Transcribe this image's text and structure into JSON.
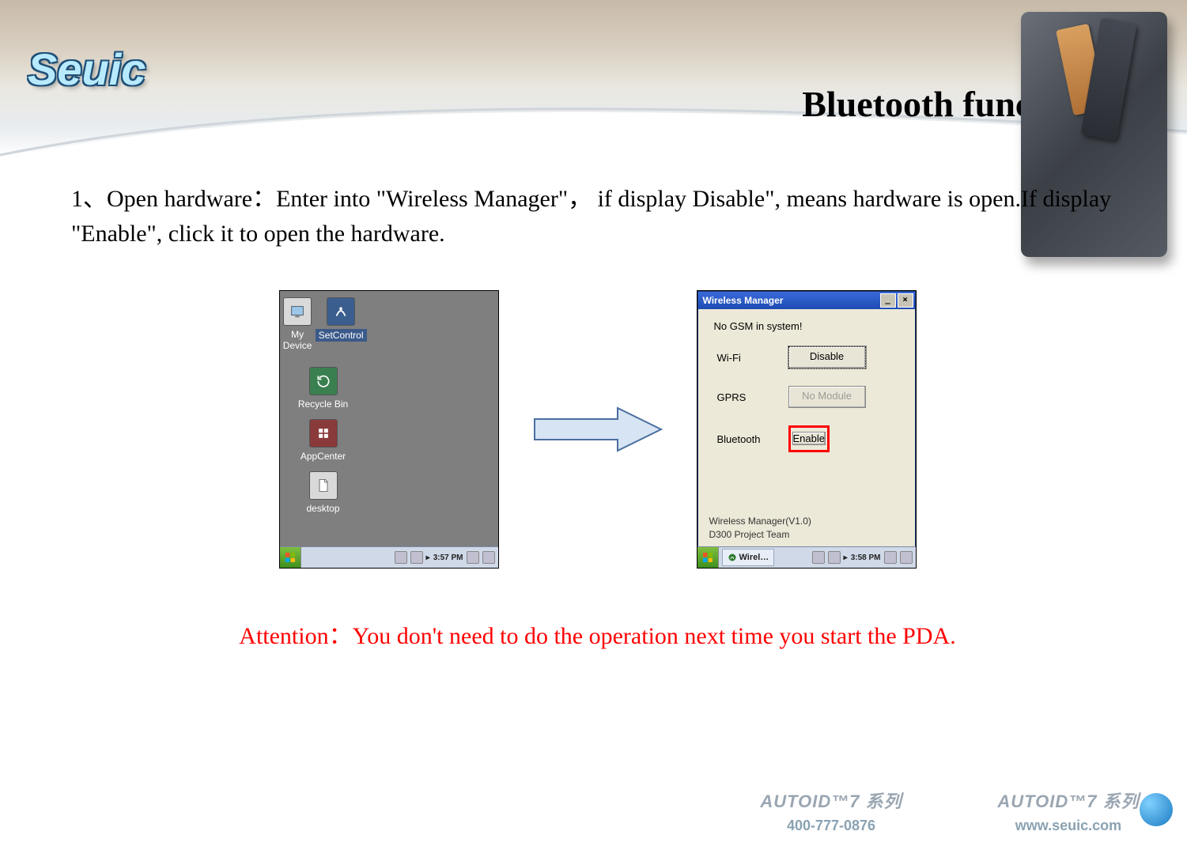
{
  "header": {
    "logo_text": "Seuic",
    "title": "Bluetooth function"
  },
  "instruction": "1、Open hardware：Enter into \"Wireless Manager\"， if display Disable\", means hardware is open.If display \"Enable\", click it to open the hardware.",
  "desktop": {
    "icons": [
      {
        "label": "My Device"
      },
      {
        "label": "SetControl"
      },
      {
        "label": "Recycle Bin"
      },
      {
        "label": "AppCenter"
      },
      {
        "label": "desktop"
      }
    ],
    "taskbar_time": "3:57 PM"
  },
  "wireless_window": {
    "title": "Wireless Manager",
    "status": "No GSM in system!",
    "rows": [
      {
        "label": "Wi-Fi",
        "button": "Disable",
        "state": "focus"
      },
      {
        "label": "GPRS",
        "button": "No Module",
        "state": "disabled"
      },
      {
        "label": "Bluetooth",
        "button": "Enable",
        "state": "highlight"
      }
    ],
    "footer_lines": [
      "Wireless Manager(V1.0)",
      "D300 Project Team"
    ],
    "taskbar_app": "Wirel…",
    "taskbar_time": "3:58 PM"
  },
  "attention": "Attention：You don't need to do the  operation next time you start the PDA.",
  "badges": {
    "brand": "AUTOID™7 系列",
    "phone": "400-777-0876",
    "url": "www.seuic.com"
  }
}
